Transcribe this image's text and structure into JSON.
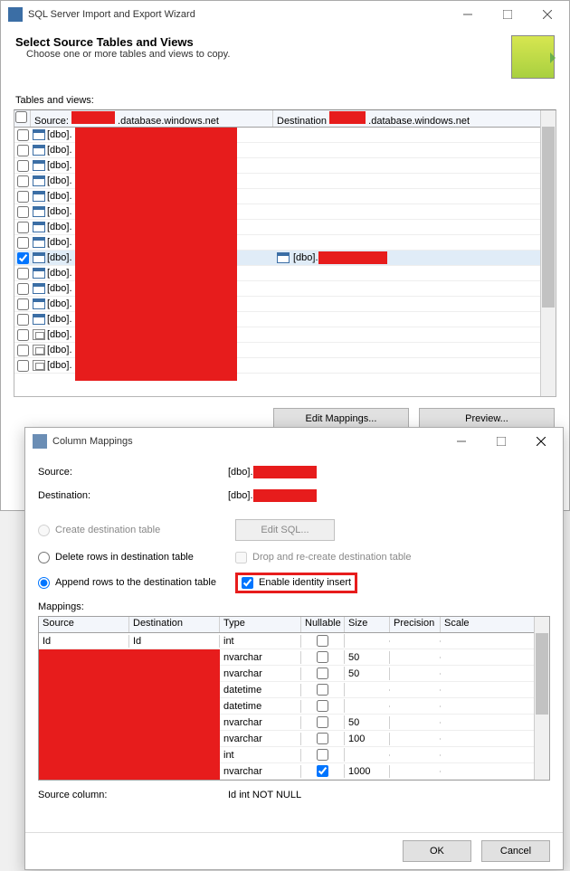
{
  "wizard": {
    "title": "SQL Server Import and Export Wizard",
    "heading": "Select Source Tables and Views",
    "subheading": "Choose one or more tables and views to copy.",
    "tables_label": "Tables and views:",
    "columns": {
      "source_prefix": "Source:",
      "source_host": ".database.windows.net",
      "dest_prefix": "Destination",
      "dest_host": ".database.windows.net"
    },
    "rows": [
      {
        "checked": false,
        "icon": "table",
        "label": "[dbo].",
        "dest": ""
      },
      {
        "checked": false,
        "icon": "table",
        "label": "[dbo].",
        "dest": ""
      },
      {
        "checked": false,
        "icon": "table",
        "label": "[dbo].",
        "dest": ""
      },
      {
        "checked": false,
        "icon": "table",
        "label": "[dbo].",
        "dest": ""
      },
      {
        "checked": false,
        "icon": "table",
        "label": "[dbo].",
        "dest": ""
      },
      {
        "checked": false,
        "icon": "table",
        "label": "[dbo].",
        "dest": ""
      },
      {
        "checked": false,
        "icon": "table",
        "label": "[dbo].",
        "dest": ""
      },
      {
        "checked": false,
        "icon": "table",
        "label": "[dbo].",
        "dest": ""
      },
      {
        "checked": true,
        "icon": "table",
        "label": "[dbo].",
        "dest": "[dbo]."
      },
      {
        "checked": false,
        "icon": "table",
        "label": "[dbo].",
        "dest": ""
      },
      {
        "checked": false,
        "icon": "table",
        "label": "[dbo].",
        "dest": ""
      },
      {
        "checked": false,
        "icon": "table",
        "label": "[dbo].",
        "dest": ""
      },
      {
        "checked": false,
        "icon": "table",
        "label": "[dbo].",
        "dest": ""
      },
      {
        "checked": false,
        "icon": "view",
        "label": "[dbo].",
        "dest": ""
      },
      {
        "checked": false,
        "icon": "view",
        "label": "[dbo].",
        "dest": ""
      },
      {
        "checked": false,
        "icon": "view",
        "label": "[dbo].",
        "dest": ""
      }
    ],
    "buttons": {
      "edit_mappings": "Edit Mappings...",
      "preview": "Preview..."
    }
  },
  "dialog": {
    "title": "Column Mappings",
    "source_label": "Source:",
    "source_value": "[dbo].",
    "dest_label": "Destination:",
    "dest_value": "[dbo].",
    "opt_create": "Create destination table",
    "edit_sql": "Edit SQL...",
    "opt_delete": "Delete rows in destination table",
    "opt_drop": "Drop and re-create destination table",
    "opt_append": "Append rows to the destination table",
    "opt_identity": "Enable identity insert",
    "mappings_label": "Mappings:",
    "map_columns": {
      "source": "Source",
      "destination": "Destination",
      "type": "Type",
      "nullable": "Nullable",
      "size": "Size",
      "precision": "Precision",
      "scale": "Scale"
    },
    "map_rows": [
      {
        "source": "Id",
        "dest": "Id",
        "type": "int",
        "nullable": false,
        "size": ""
      },
      {
        "source": "",
        "dest": "",
        "type": "nvarchar",
        "nullable": false,
        "size": "50"
      },
      {
        "source": "",
        "dest": "",
        "type": "nvarchar",
        "nullable": false,
        "size": "50"
      },
      {
        "source": "",
        "dest": "",
        "type": "datetime",
        "nullable": false,
        "size": ""
      },
      {
        "source": "",
        "dest": "",
        "type": "datetime",
        "nullable": false,
        "size": ""
      },
      {
        "source": "",
        "dest": "",
        "type": "nvarchar",
        "nullable": false,
        "size": "50"
      },
      {
        "source": "",
        "dest": "",
        "type": "nvarchar",
        "nullable": false,
        "size": "100"
      },
      {
        "source": "",
        "dest": "",
        "type": "int",
        "nullable": false,
        "size": ""
      },
      {
        "source": "",
        "dest": "",
        "type": "nvarchar",
        "nullable": true,
        "size": "1000"
      }
    ],
    "src_col_label": "Source column:",
    "src_col_value": "Id int NOT NULL",
    "ok": "OK",
    "cancel": "Cancel"
  }
}
